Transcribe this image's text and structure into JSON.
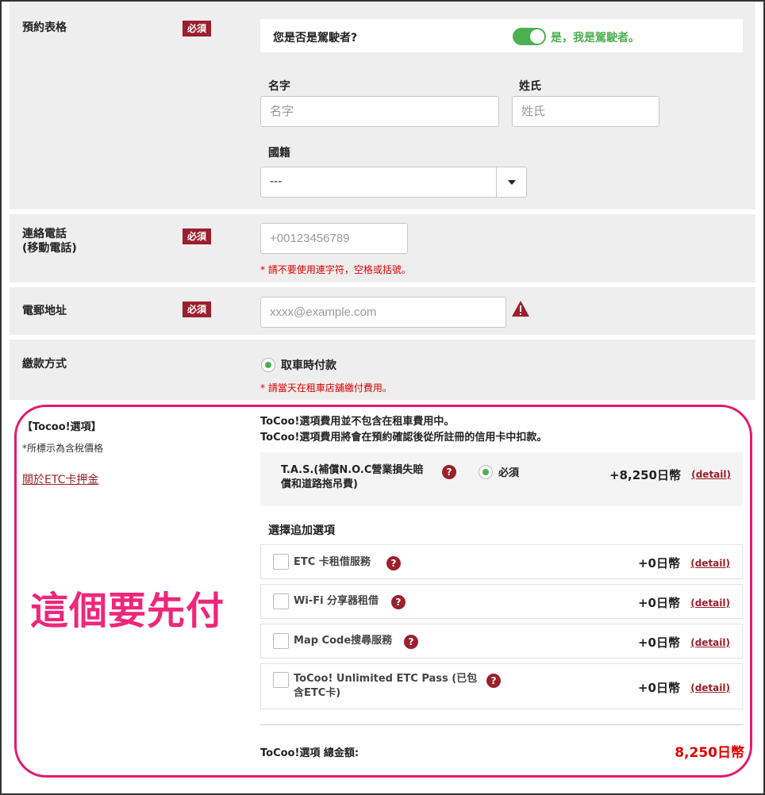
{
  "required_badge": "必須",
  "booking": {
    "label": "預約表格",
    "driver_question": "您是否是駕駛者?",
    "driver_answer": "是，我是駕駛者。",
    "first_name_label": "名字",
    "first_name_placeholder": "名字",
    "last_name_label": "姓氏",
    "last_name_placeholder": "姓氏",
    "nationality_label": "國籍",
    "nationality_value": "---"
  },
  "phone": {
    "label_line1": "連絡電話",
    "label_line2": "(移動電話)",
    "placeholder": "+00123456789",
    "note": "* 請不要使用連字符，空格或括號。"
  },
  "email": {
    "label": "電郵地址",
    "placeholder": "xxxx@example.com"
  },
  "payment": {
    "label": "繳款方式",
    "option": "取車時付款",
    "note": "* 請當天在租車店舖繳付費用。"
  },
  "options": {
    "title": "【Tocoo!選項】",
    "tax_note": "*所標示為含稅價格",
    "etc_link": "關於ETC卡押金",
    "desc_line1": "ToCoo!選項費用並不包含在租車費用中。",
    "desc_line2": "ToCoo!選項費用將會在預約確認後從所註冊的信用卡中扣款。",
    "tas": {
      "name_line1": "T.A.S.(補償N.O.C營業損失賠",
      "name_line2": "償和道路拖吊費)",
      "required": "必須",
      "price": "+8,250日幣",
      "detail": "(detail)"
    },
    "additional_title": "選擇追加選項",
    "items": [
      {
        "name": "ETC 卡租借服務",
        "price": "+0日幣",
        "detail": "(detail)"
      },
      {
        "name": "Wi-Fi 分享器租借",
        "price": "+0日幣",
        "detail": "(detail)"
      },
      {
        "name": "Map Code搜尋服務",
        "price": "+0日幣",
        "detail": "(detail)"
      },
      {
        "name_line1": "ToCoo! Unlimited ETC Pass (已包",
        "name_line2": "含ETC卡)",
        "price": "+0日幣",
        "detail": "(detail)"
      }
    ],
    "total_label": "ToCoo!選項 總金額:",
    "total_value": "8,250日幣"
  },
  "annotation": "這個要先付",
  "colors": {
    "required_badge": "#9c1f2c",
    "toggle_on": "#4caf50",
    "note_red": "#e00000",
    "annotation_pink": "#f0267a"
  }
}
